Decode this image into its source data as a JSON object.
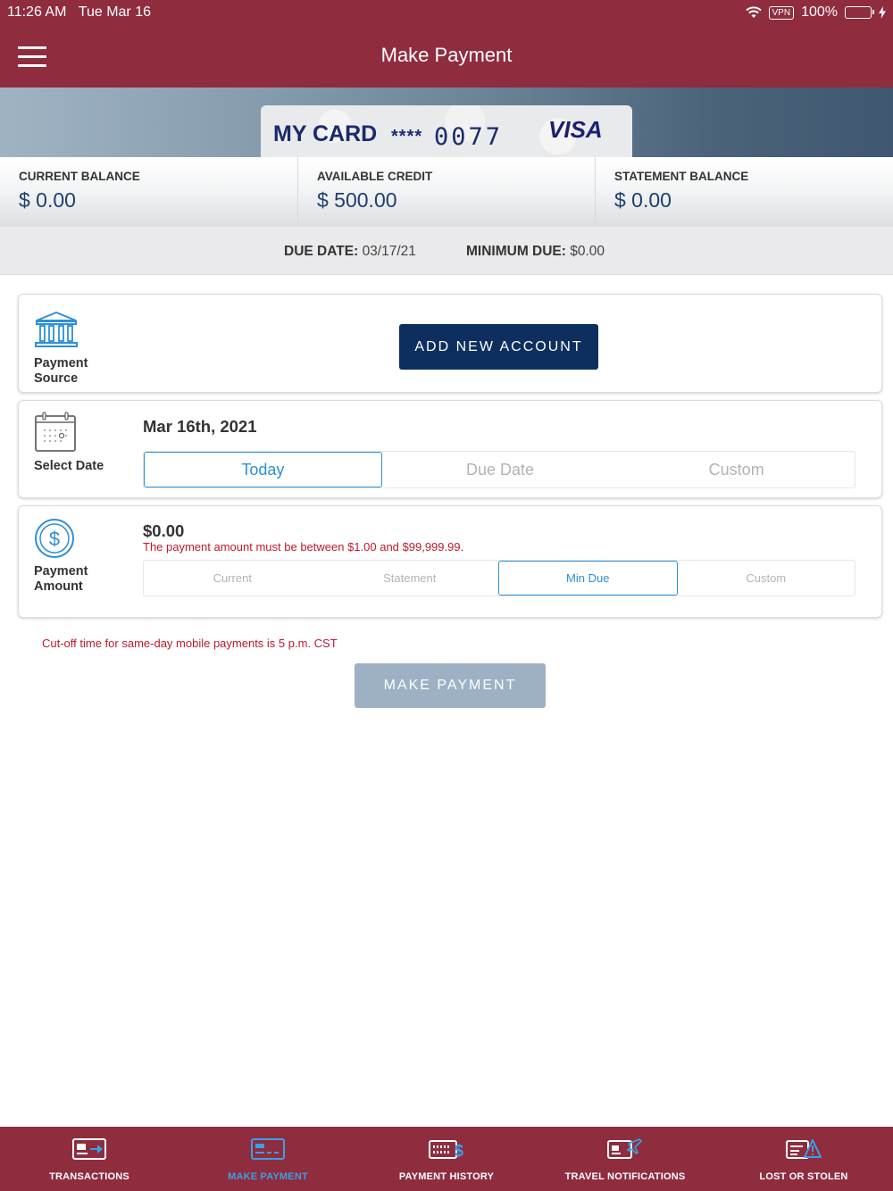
{
  "status_bar": {
    "time": "11:26 AM",
    "date": "Tue Mar 16",
    "vpn": "VPN",
    "battery": "100%"
  },
  "header": {
    "title": "Make Payment"
  },
  "card": {
    "name": "MY CARD",
    "masked": "****",
    "last4": "0077",
    "brand": "VISA"
  },
  "balances": [
    {
      "label": "CURRENT BALANCE",
      "value": "$ 0.00"
    },
    {
      "label": "AVAILABLE CREDIT",
      "value": "$ 500.00"
    },
    {
      "label": "STATEMENT BALANCE",
      "value": "$ 0.00"
    }
  ],
  "due": {
    "date_label": "DUE DATE:",
    "date_value": "03/17/21",
    "min_label": "MINIMUM DUE:",
    "min_value": "$0.00"
  },
  "payment_source": {
    "label_line1": "Payment",
    "label_line2": "Source",
    "button": "ADD NEW ACCOUNT"
  },
  "select_date": {
    "label": "Select Date",
    "value": "Mar 16th, 2021",
    "options": [
      "Today",
      "Due Date",
      "Custom"
    ],
    "selected": "Today"
  },
  "payment_amount": {
    "label_line1": "Payment",
    "label_line2": "Amount",
    "value": "$0.00",
    "error": "The payment amount must be between $1.00 and $99,999.99.",
    "options": [
      "Current",
      "Statement",
      "Min Due",
      "Custom"
    ],
    "selected": "Min Due"
  },
  "cutoff_note": "Cut-off time for same-day mobile payments is 5 p.m. CST",
  "make_payment_button": "MAKE PAYMENT",
  "colors": {
    "brand": "#8f2c3e",
    "navy": "#0d2f5f",
    "accent": "#2d8fd6",
    "error": "#c0182f",
    "disabled": "#9db0c4"
  },
  "tabs": [
    {
      "label": "TRANSACTIONS",
      "icon": "transactions-icon"
    },
    {
      "label": "MAKE PAYMENT",
      "icon": "make-payment-icon",
      "active": true
    },
    {
      "label": "PAYMENT HISTORY",
      "icon": "payment-history-icon"
    },
    {
      "label": "TRAVEL NOTIFICATIONS",
      "icon": "travel-notifications-icon"
    },
    {
      "label": "LOST OR STOLEN",
      "icon": "lost-or-stolen-icon"
    }
  ]
}
